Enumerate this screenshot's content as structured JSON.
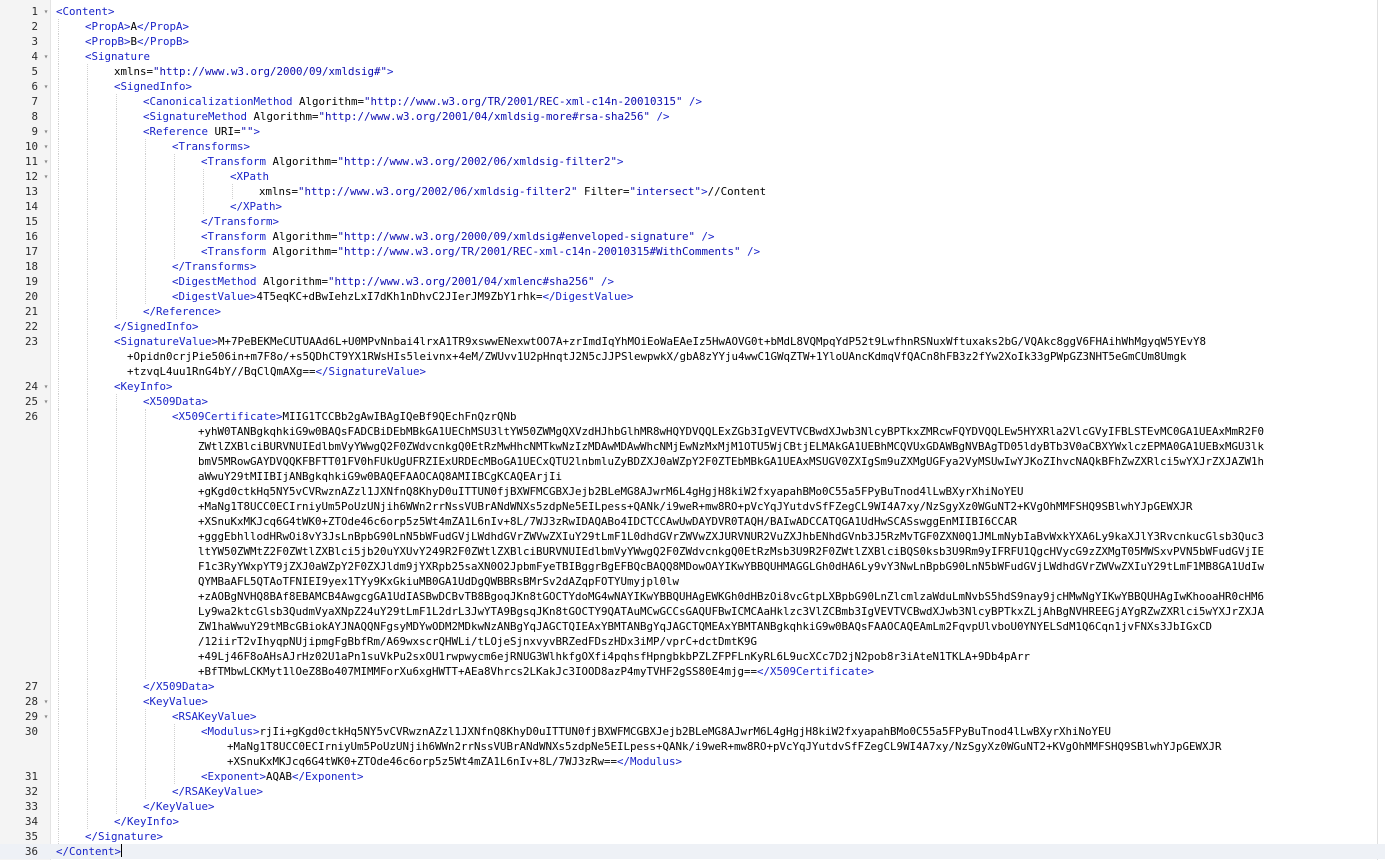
{
  "editor": {
    "lines": [
      {
        "n": "1",
        "fold": "▾",
        "indent": 0,
        "segs": [
          [
            "tag",
            "<Content>"
          ]
        ]
      },
      {
        "n": "2",
        "fold": "",
        "indent": 1,
        "segs": [
          [
            "tag",
            "<PropA>"
          ],
          [
            "tx",
            "A"
          ],
          [
            "tag",
            "</PropA>"
          ]
        ]
      },
      {
        "n": "3",
        "fold": "",
        "indent": 1,
        "segs": [
          [
            "tag",
            "<PropB>"
          ],
          [
            "tx",
            "B"
          ],
          [
            "tag",
            "</PropB>"
          ]
        ]
      },
      {
        "n": "4",
        "fold": "▾",
        "indent": 1,
        "segs": [
          [
            "tag",
            "<Signature"
          ]
        ]
      },
      {
        "n": "5",
        "fold": "",
        "indent": 2,
        "segs": [
          [
            "an",
            "xmlns="
          ],
          [
            "av",
            "\"http://www.w3.org/2000/09/xmldsig#\""
          ],
          [
            "tag",
            ">"
          ]
        ]
      },
      {
        "n": "6",
        "fold": "▾",
        "indent": 2,
        "segs": [
          [
            "tag",
            "<SignedInfo>"
          ]
        ]
      },
      {
        "n": "7",
        "fold": "",
        "indent": 3,
        "segs": [
          [
            "tag",
            "<CanonicalizationMethod "
          ],
          [
            "an",
            "Algorithm="
          ],
          [
            "av",
            "\"http://www.w3.org/TR/2001/REC-xml-c14n-20010315\""
          ],
          [
            "tag",
            " />"
          ]
        ]
      },
      {
        "n": "8",
        "fold": "",
        "indent": 3,
        "segs": [
          [
            "tag",
            "<SignatureMethod "
          ],
          [
            "an",
            "Algorithm="
          ],
          [
            "av",
            "\"http://www.w3.org/2001/04/xmldsig-more#rsa-sha256\""
          ],
          [
            "tag",
            " />"
          ]
        ]
      },
      {
        "n": "9",
        "fold": "▾",
        "indent": 3,
        "segs": [
          [
            "tag",
            "<Reference "
          ],
          [
            "an",
            "URI="
          ],
          [
            "av",
            "\"\""
          ],
          [
            "tag",
            ">"
          ]
        ]
      },
      {
        "n": "10",
        "fold": "▾",
        "indent": 4,
        "segs": [
          [
            "tag",
            "<Transforms>"
          ]
        ]
      },
      {
        "n": "11",
        "fold": "▾",
        "indent": 5,
        "segs": [
          [
            "tag",
            "<Transform "
          ],
          [
            "an",
            "Algorithm="
          ],
          [
            "av",
            "\"http://www.w3.org/2002/06/xmldsig-filter2\""
          ],
          [
            "tag",
            ">"
          ]
        ]
      },
      {
        "n": "12",
        "fold": "▾",
        "indent": 6,
        "segs": [
          [
            "tag",
            "<XPath"
          ]
        ]
      },
      {
        "n": "13",
        "fold": "",
        "indent": 7,
        "segs": [
          [
            "an",
            "xmlns="
          ],
          [
            "av",
            "\"http://www.w3.org/2002/06/xmldsig-filter2\""
          ],
          [
            "an",
            " Filter="
          ],
          [
            "av",
            "\"intersect\""
          ],
          [
            "tag",
            ">"
          ],
          [
            "tx",
            "//Content"
          ]
        ]
      },
      {
        "n": "14",
        "fold": "",
        "indent": 6,
        "segs": [
          [
            "tag",
            "</XPath>"
          ]
        ]
      },
      {
        "n": "15",
        "fold": "",
        "indent": 5,
        "segs": [
          [
            "tag",
            "</Transform>"
          ]
        ]
      },
      {
        "n": "16",
        "fold": "",
        "indent": 5,
        "segs": [
          [
            "tag",
            "<Transform "
          ],
          [
            "an",
            "Algorithm="
          ],
          [
            "av",
            "\"http://www.w3.org/2000/09/xmldsig#enveloped-signature\""
          ],
          [
            "tag",
            " />"
          ]
        ]
      },
      {
        "n": "17",
        "fold": "",
        "indent": 5,
        "segs": [
          [
            "tag",
            "<Transform "
          ],
          [
            "an",
            "Algorithm="
          ],
          [
            "av",
            "\"http://www.w3.org/TR/2001/REC-xml-c14n-20010315#WithComments\""
          ],
          [
            "tag",
            " />"
          ]
        ]
      },
      {
        "n": "18",
        "fold": "",
        "indent": 4,
        "segs": [
          [
            "tag",
            "</Transforms>"
          ]
        ]
      },
      {
        "n": "19",
        "fold": "",
        "indent": 4,
        "segs": [
          [
            "tag",
            "<DigestMethod "
          ],
          [
            "an",
            "Algorithm="
          ],
          [
            "av",
            "\"http://www.w3.org/2001/04/xmlenc#sha256\""
          ],
          [
            "tag",
            " />"
          ]
        ]
      },
      {
        "n": "20",
        "fold": "",
        "indent": 4,
        "segs": [
          [
            "tag",
            "<DigestValue>"
          ],
          [
            "tx",
            "4T5eqKC+dBwIehzLxI7dKh1nDhvC2JIerJM9ZbY1rhk="
          ],
          [
            "tag",
            "</DigestValue>"
          ]
        ]
      },
      {
        "n": "21",
        "fold": "",
        "indent": 3,
        "segs": [
          [
            "tag",
            "</Reference>"
          ]
        ]
      },
      {
        "n": "22",
        "fold": "",
        "indent": 2,
        "segs": [
          [
            "tag",
            "</SignedInfo>"
          ]
        ]
      },
      {
        "n": "23",
        "fold": "",
        "indent": 2,
        "rows": [
          [
            [
              "tag",
              "<SignatureValue>"
            ],
            [
              "tx",
              "M+7PeBEKMeCUTUAAd6L+U0MPvNnbai4lrxA1TR9xswwENexwtOO7A+zrImdIqYhMOiEoWaEAeIz5HwAOVG0t+bMdL8VQMpqYdP52t9LwfhnRSNuxWftuxaks2bG/VQAkc8ggV6FHAihWhMgyqW5YEvY8"
            ]
          ],
          [
            [
              "tx",
              "  +Opidn0crjPie506in+m7F8o/+s5QDhCT9YX1RWsHIs5leivnx+4eM/ZWUvv1U2pHnqtJ2N5cJJPSlewpwkX/gbA8zYYju4wwC1GWqZTW+1YloUAncKdmqVfQACn8hFB3z2fYw2XoIk33gPWpGZ3NHT5eGmCUm8Umgk"
            ]
          ],
          [
            [
              "tx",
              "  +tzvqL4uu1RnG4bY//BqClQmAXg=="
            ],
            [
              "tag",
              "</SignatureValue>"
            ]
          ]
        ]
      },
      {
        "n": "24",
        "fold": "▾",
        "indent": 2,
        "segs": [
          [
            "tag",
            "<KeyInfo>"
          ]
        ]
      },
      {
        "n": "25",
        "fold": "▾",
        "indent": 3,
        "segs": [
          [
            "tag",
            "<X509Data>"
          ]
        ]
      },
      {
        "n": "26",
        "fold": "",
        "indent": 4,
        "rows": [
          [
            [
              "tag",
              "<X509Certificate>"
            ],
            [
              "tx",
              "MIIG1TCCBb2gAwIBAgIQeBf9QEchFnQzrQNb"
            ]
          ],
          [
            [
              "tx",
              "    +yhW0TANBgkqhkiG9w0BAQsFADCBiDEbMBkGA1UEChMSU3ltYW50ZWMgQXVzdHJhbGlhMR8wHQYDVQQLExZGb3IgVEVTVCBwdXJwb3NlcyBPTkxZMRcwFQYDVQQLEw5HYXRla2VlcGVyIFBLSTEvMC0GA1UEAxMmR2F0"
            ]
          ],
          [
            [
              "tx",
              "    ZWtlZXBlciBURVNUIEdlbmVyYWwgQ2F0ZWdvcnkgQ0EtRzMwHhcNMTkwNzIzMDAwMDAwWhcNMjEwNzMxMjM1OTU5WjCBtjELMAkGA1UEBhMCQVUxGDAWBgNVBAgTD05ldyBTb3V0aCBXYWxlczEPMA0GA1UEBxMGU3lk"
            ]
          ],
          [
            [
              "tx",
              "    bmV5MRowGAYDVQQKFBFTT01FV0hFUkUgUFRZIExURDEcMBoGA1UECxQTU2lnbmluZyBDZXJ0aWZpY2F0ZTEbMBkGA1UEAxMSUGV0ZXIgSm9uZXMgUGFya2VyMSUwIwYJKoZIhvcNAQkBFhZwZXRlci5wYXJrZXJAZW1h"
            ]
          ],
          [
            [
              "tx",
              "    aWwuY29tMIIBIjANBgkqhkiG9w0BAQEFAAOCAQ8AMIIBCgKCAQEArjIi"
            ]
          ],
          [
            [
              "tx",
              "    +gKgd0ctkHq5NY5vCVRwznAZzl1JXNfnQ8KhyD0uITTUN0fjBXWFMCGBXJejb2BLeMG8AJwrM6L4gHgjH8kiW2fxyapahBMo0C55a5FPyBuTnod4lLwBXyrXhiNoYEU"
            ]
          ],
          [
            [
              "tx",
              "    +MaNg1T8UCC0ECIrniyUm5PoUzUNjih6WWn2rrNssVUBrANdWNXs5zdpNe5EILpess+QANk/i9weR+mw8RO+pVcYqJYutdvSfFZegCL9WI4A7xy/NzSgyXz0WGuNT2+KVgOhMMFSHQ9SBlwhYJpGEWXJR"
            ]
          ],
          [
            [
              "tx",
              "    +XSnuKxMKJcq6G4tWK0+ZTOde46c6orp5z5Wt4mZA1L6nIv+8L/7WJ3zRwIDAQABo4IDCTCCAwUwDAYDVR0TAQH/BAIwADCCATQGA1UdHwSCASswggEnMIIBI6CCAR"
            ]
          ],
          [
            [
              "tx",
              "    +gggEbhllodHRwOi8vY3JsLnBpbG90LnN5bWFudGVjLWdhdGVrZWVwZXIuY29tLmF1L0dhdGVrZWVwZXJURVNUR2VuZXJhbENhdGVnb3J5RzMvTGF0ZXN0Q1JMLmNybIaBvWxkYXA6Ly9kaXJlY3RvcnkucGlsb3Quc3"
            ]
          ],
          [
            [
              "tx",
              "    ltYW50ZWMtZ2F0ZWtlZXBlci5jb20uYXUvY249R2F0ZWtlZXBlciBURVNUIEdlbmVyYWwgQ2F0ZWdvcnkgQ0EtRzMsb3U9R2F0ZWtlZXBlciBQS0ksb3U9Rm9yIFRFU1QgcHVycG9zZXMgT05MWSxvPVN5bWFudGVjIE"
            ]
          ],
          [
            [
              "tx",
              "    F1c3RyYWxpYT9jZXJ0aWZpY2F0ZXJldm9jYXRpb25saXN0O2JpbmFyeTBIBggrBgEFBQcBAQQ8MDowOAYIKwYBBQUHMAGGLGh0dHA6Ly9vY3NwLnBpbG90LnN5bWFudGVjLWdhdGVrZWVwZXIuY29tLmF1MB8GA1UdIw"
            ]
          ],
          [
            [
              "tx",
              "    QYMBaAFL5QTAoTFNIEI9yex1TYy9KxGkiuMB0GA1UdDgQWBBRsBMrSv2dAZqpFOTYUmyjpl0lw"
            ]
          ],
          [
            [
              "tx",
              "    +zAOBgNVHQ8BAf8EBAMCB4AwgcgGA1UdIASBwDCBvTB8BgoqJKn8tGOCTYdoMG4wNAYIKwYBBQUHAgEWKGh0dHBzOi8vcGtpLXBpbG90LnZlcmlzaWduLmNvbS5hdS9nay9jcHMwNgYIKwYBBQUHAgIwKhooaHR0cHM6"
            ]
          ],
          [
            [
              "tx",
              "    Ly9wa2ktcGlsb3QudmVyaXNpZ24uY29tLmF1L2drL3JwYTA9BgsqJKn8tGOCTY9QATAuMCwGCCsGAQUFBwICMCAaHklzc3VlZCBmb3IgVEVTVCBwdXJwb3NlcyBPTkxZLjAhBgNVHREEGjAYgRZwZXRlci5wYXJrZXJA"
            ]
          ],
          [
            [
              "tx",
              "    ZW1haWwuY29tMBcGBiokAYJNAQQNFgsyMDYwODM2MDkwNzANBgYqJAGCTQIEAxYBMTANBgYqJAGCTQMEAxYBMTANBgkqhkiG9w0BAQsFAAOCAQEAmLm2FqvpUlvboU0YNYELSdM1Q6Cqn1jvFNXs3JbIGxCD"
            ]
          ],
          [
            [
              "tx",
              "    /12iirT2vIhyqpNUjipmgFgBbfRm/A69wxscrQHWLi/tLOjeSjnxvyvBRZedFDszHDx3iMP/vprC+dctDmtK9G"
            ]
          ],
          [
            [
              "tx",
              "    +49Lj46F8oAHsAJrHz02U1aPn1suVkPu2sxOU1rwpwycm6ejRNUG3WlhkfgOXfi4pqhsfHpngbkbPZLZFPFLnKyRL6L9ucXCc7D2jN2pob8r3iAteN1TKLA+9Db4pArr"
            ]
          ],
          [
            [
              "tx",
              "    +BfTMbwLCKMyt1lOeZ8Bo407MIMMForXu6xgHWTT+AEa8Vhrcs2LKakJc3IOOD8azP4myTVHF2gSS80E4mjg=="
            ],
            [
              "tag",
              "</X509Certificate>"
            ]
          ]
        ]
      },
      {
        "n": "27",
        "fold": "",
        "indent": 3,
        "segs": [
          [
            "tag",
            "</X509Data>"
          ]
        ]
      },
      {
        "n": "28",
        "fold": "▾",
        "indent": 3,
        "segs": [
          [
            "tag",
            "<KeyValue>"
          ]
        ]
      },
      {
        "n": "29",
        "fold": "▾",
        "indent": 4,
        "segs": [
          [
            "tag",
            "<RSAKeyValue>"
          ]
        ]
      },
      {
        "n": "30",
        "fold": "",
        "indent": 5,
        "rows": [
          [
            [
              "tag",
              "<Modulus>"
            ],
            [
              "tx",
              "rjIi+gKgd0ctkHq5NY5vCVRwznAZzl1JXNfnQ8KhyD0uITTUN0fjBXWFMCGBXJejb2BLeMG8AJwrM6L4gHgjH8kiW2fxyapahBMo0C55a5FPyBuTnod4lLwBXyrXhiNoYEU"
            ]
          ],
          [
            [
              "tx",
              "    +MaNg1T8UCC0ECIrniyUm5PoUzUNjih6WWn2rrNssVUBrANdWNXs5zdpNe5EILpess+QANk/i9weR+mw8RO+pVcYqJYutdvSfFZegCL9WI4A7xy/NzSgyXz0WGuNT2+KVgOhMMFSHQ9SBlwhYJpGEWXJR"
            ]
          ],
          [
            [
              "tx",
              "    +XSnuKxMKJcq6G4tWK0+ZTOde46c6orp5z5Wt4mZA1L6nIv+8L/7WJ3zRw=="
            ],
            [
              "tag",
              "</Modulus>"
            ]
          ]
        ]
      },
      {
        "n": "31",
        "fold": "",
        "indent": 5,
        "segs": [
          [
            "tag",
            "<Exponent>"
          ],
          [
            "tx",
            "AQAB"
          ],
          [
            "tag",
            "</Exponent>"
          ]
        ]
      },
      {
        "n": "32",
        "fold": "",
        "indent": 4,
        "segs": [
          [
            "tag",
            "</RSAKeyValue>"
          ]
        ]
      },
      {
        "n": "33",
        "fold": "",
        "indent": 3,
        "segs": [
          [
            "tag",
            "</KeyValue>"
          ]
        ]
      },
      {
        "n": "34",
        "fold": "",
        "indent": 2,
        "segs": [
          [
            "tag",
            "</KeyInfo>"
          ]
        ]
      },
      {
        "n": "35",
        "fold": "",
        "indent": 1,
        "segs": [
          [
            "tag",
            "</Signature>"
          ]
        ]
      },
      {
        "n": "36",
        "fold": "",
        "indent": 0,
        "current": true,
        "segs": [
          [
            "tag",
            "</Content>"
          ]
        ]
      }
    ]
  }
}
